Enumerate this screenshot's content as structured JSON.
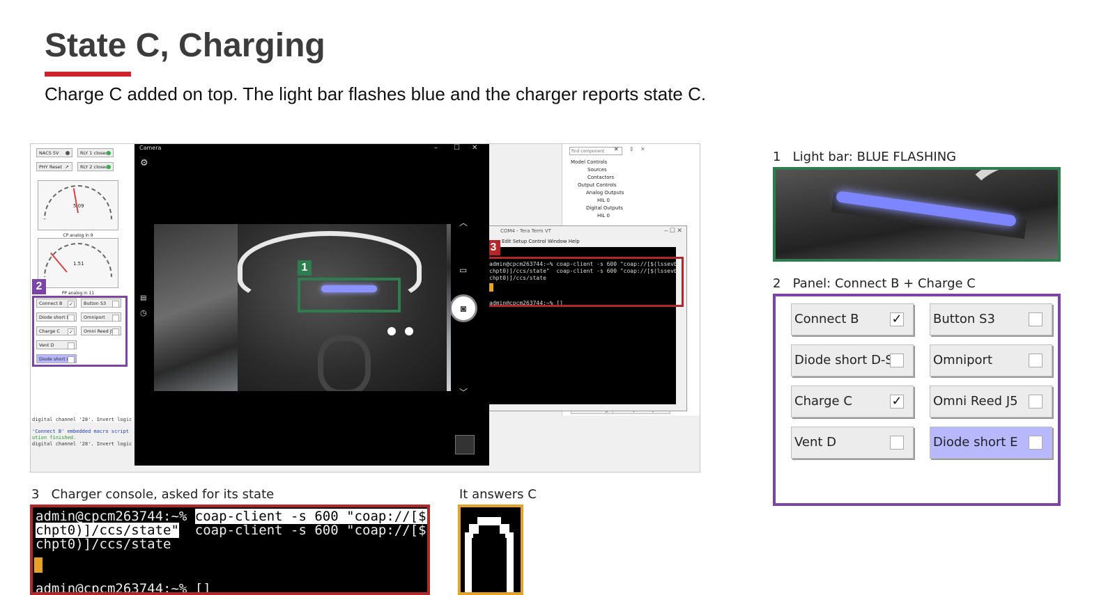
{
  "slide": {
    "title": "State C, Charging",
    "subtitle": "Charge C added on top. The light bar flashes blue and the charger reports state C."
  },
  "colors": {
    "accent_red": "#d4202a",
    "marker_green": "#2e7d4f",
    "marker_purple": "#7a44a8",
    "marker_red": "#b5262a",
    "marker_orange": "#e6a323",
    "selected_button": "#b8b8ff"
  },
  "screenshot": {
    "top_controls": [
      {
        "label": "NACS 5V",
        "indicator": "gray"
      },
      {
        "label": "RLY 1 closed",
        "indicator": "green"
      },
      {
        "label": "PHY Reset",
        "indicator": "arrow"
      },
      {
        "label": "RLY 2 closed",
        "indicator": "green"
      }
    ],
    "gauges": [
      {
        "value": "5.09",
        "caption": "CP analog in 9"
      },
      {
        "value": "1.51",
        "caption": "PP analog in 11"
      }
    ],
    "mini_panel": [
      {
        "label": "Connect B",
        "checked": "✓"
      },
      {
        "label": "Button S3",
        "checked": ""
      },
      {
        "label": "Diode short D-S",
        "checked": ""
      },
      {
        "label": "Omniport",
        "checked": ""
      },
      {
        "label": "Charge C",
        "checked": "✓"
      },
      {
        "label": "Omni Reed J5",
        "checked": ""
      },
      {
        "label": "Vent D",
        "checked": ""
      },
      {
        "label": "Diode short E",
        "checked": ""
      }
    ],
    "log_lines": [
      "digital channel '28'. Invert logic",
      "'Connect B' embedded macro script",
      "ution finished.",
      "digital channel '28'. Invert logic"
    ],
    "camera": {
      "title": "Camera"
    },
    "tree": {
      "search_placeholder": "find component",
      "items": [
        "Model Controls",
        "Sources",
        "Contactors",
        "Output Controls",
        "Analog Outputs",
        "HIL 0",
        "Digital Outputs",
        "HIL 0"
      ],
      "tabs": [
        "Model Settings",
        "Namespace Explorer"
      ]
    },
    "teraterm": {
      "title": "COM4 - Tera Term VT",
      "menu": "Edit   Setup   Control   Window   Help",
      "lines": [
        "admin@cpcm263744:~% coap-client -s 600 \"coap://[$(lssevb",
        "chpt0)]/ccs/state\"  coap-client -s 600 \"coap://[$(lssevb",
        "chpt0)]/ccs/state",
        "",
        "admin@cpcm263744:~% []"
      ]
    },
    "badges": [
      "1",
      "2",
      "3"
    ]
  },
  "sections": {
    "light_bar": {
      "number": "1",
      "label": "Light bar: BLUE FLASHING"
    },
    "panel": {
      "number": "2",
      "label": "Panel: Connect B + Charge C",
      "buttons": [
        {
          "label": "Connect B",
          "checked": "✓",
          "selected": false
        },
        {
          "label": "Button S3",
          "checked": "",
          "selected": false
        },
        {
          "label": "Diode short D-S",
          "checked": "",
          "selected": false
        },
        {
          "label": "Omniport",
          "checked": "",
          "selected": false
        },
        {
          "label": "Charge C",
          "checked": "✓",
          "selected": false
        },
        {
          "label": "Omni Reed J5",
          "checked": "",
          "selected": false
        },
        {
          "label": "Vent D",
          "checked": "",
          "selected": false
        },
        {
          "label": "Diode short E",
          "checked": "",
          "selected": true
        }
      ]
    },
    "console": {
      "number": "3",
      "label": "Charger console, asked for its state",
      "lines": [
        {
          "prompt": "admin@cpcm263744:~% ",
          "cmd": "coap-client -s 600 \"coap://[$(lssevb"
        },
        {
          "prompt": "",
          "cmd": "chpt0)]/ccs/state\"",
          "tail": "  coap-client -s 600 \"coap://[$(lssevb"
        },
        {
          "prompt": "chpt0)]/ccs/state",
          "cmd": ""
        },
        {
          "prompt": "admin@cpcm263744:~% []",
          "cmd": ""
        }
      ]
    },
    "answer": {
      "label": "It answers  C",
      "glyph": "C"
    }
  }
}
